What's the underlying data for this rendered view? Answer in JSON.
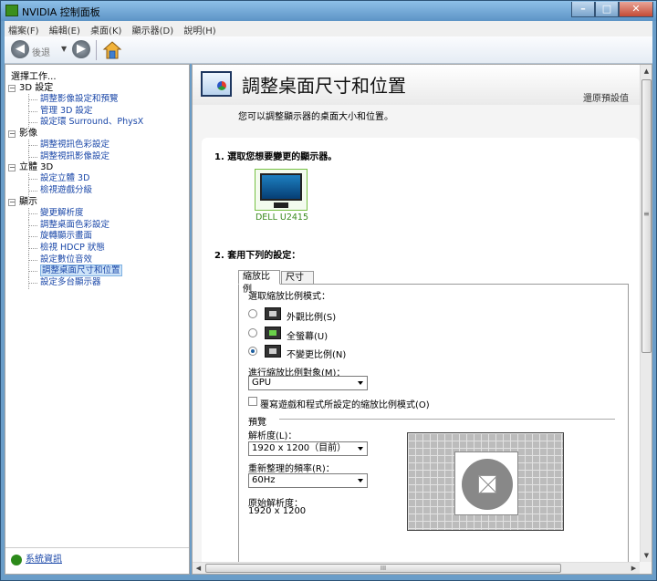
{
  "window": {
    "title": "NVIDIA 控制面板",
    "minimize_glyph": "–",
    "maximize_glyph": "□",
    "close_glyph": "✕"
  },
  "menu": [
    "檔案(F)",
    "編輯(E)",
    "桌面(K)",
    "顯示器(D)",
    "說明(H)"
  ],
  "toolbar": {
    "back_label": "後退",
    "back_glyph": "◀",
    "forward_glyph": "▶",
    "dropdown_glyph": "▼"
  },
  "sidebar": {
    "header": "選擇工作...",
    "categories": [
      {
        "label": "3D 設定",
        "toggle": "−",
        "items": [
          "調整影像設定和預覽",
          "管理 3D 設定",
          "設定環 Surround、PhysX"
        ]
      },
      {
        "label": "影像",
        "toggle": "−",
        "items": [
          "調整視訊色彩設定",
          "調整視訊影像設定"
        ]
      },
      {
        "label": "立體 3D",
        "toggle": "−",
        "items": [
          "設定立體 3D",
          "檢視遊戲分級"
        ]
      },
      {
        "label": "顯示",
        "toggle": "−",
        "items": [
          "變更解析度",
          "調整桌面色彩設定",
          "旋轉顯示畫面",
          "檢視 HDCP 狀態",
          "設定數位音效",
          "調整桌面尺寸和位置",
          "設定多台顯示器"
        ]
      }
    ],
    "system_info": "系統資訊"
  },
  "page": {
    "title": "調整桌面尺寸和位置",
    "restore_defaults": "還原預設值",
    "description": "您可以調整顯示器的桌面大小和位置。",
    "section1": "1. 選取您想要變更的顯示器。",
    "monitor_label": "DELL U2415",
    "section2": "2. 套用下列的設定：",
    "tabs": [
      "縮放比例",
      "尺寸"
    ],
    "scaling_mode_label": "選取縮放比例模式：",
    "scaling_options": [
      "外觀比例(S)",
      "全螢幕(U)",
      "不變更比例(N)"
    ],
    "selected_option": 2,
    "perform_on_label": "進行縮放比例對象(M)：",
    "perform_on_value": "GPU",
    "override_label": "覆寫遊戲和程式所設定的縮放比例模式(O)",
    "override_checked": false,
    "preview_label": "預覽",
    "resolution_label": "解析度(L)：",
    "resolution_value": "1920 x 1200（目前）",
    "refresh_label": "重新整理的頻率(R)：",
    "refresh_value": "60Hz",
    "native_label": "原始解析度：",
    "native_value": "1920 x 1200"
  },
  "scrollbars": {
    "up": "▲",
    "down": "▼",
    "left": "◀",
    "right": "▶",
    "v_grip": "≡",
    "h_grip": "III"
  },
  "colors": {
    "title_bar": "#6a9dc8",
    "link": "#1a47a8",
    "selection": "#cde3f8",
    "nvidia_green": "#76c043"
  }
}
